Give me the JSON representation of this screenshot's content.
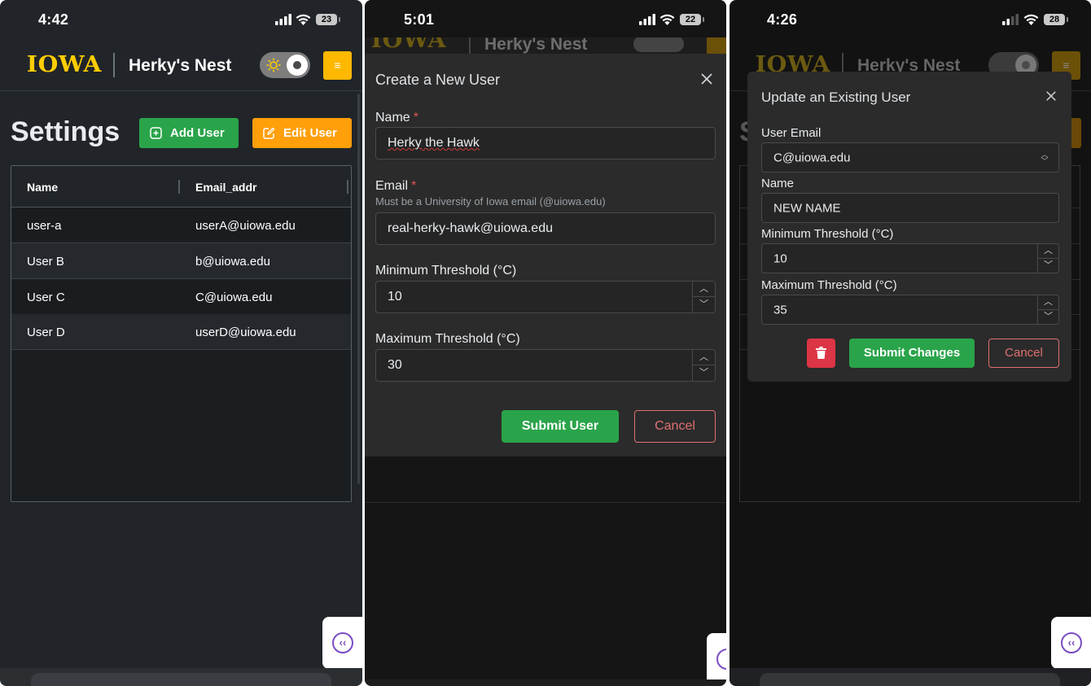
{
  "panel1": {
    "status": {
      "time": "4:42",
      "battery": "23"
    },
    "header": {
      "logo": "IOWA",
      "title": "Herky's Nest"
    },
    "page_title": "Settings",
    "add_user_label": "Add User",
    "edit_user_label": "Edit User",
    "table": {
      "columns": [
        "Name",
        "Email_addr"
      ],
      "rows": [
        {
          "name": "user-a",
          "email": "userA@uiowa.edu"
        },
        {
          "name": "User B",
          "email": "b@uiowa.edu"
        },
        {
          "name": "User C",
          "email": "C@uiowa.edu"
        },
        {
          "name": "User D",
          "email": "userD@uiowa.edu"
        }
      ]
    },
    "side_tab_icon": "‹‹"
  },
  "panel2": {
    "status": {
      "time": "5:01",
      "battery": "22"
    },
    "header": {
      "logo": "IOWA",
      "title": "Herky's Nest"
    },
    "modal": {
      "title": "Create a New User",
      "name_label": "Name",
      "name_value": "Herky the Hawk",
      "email_label": "Email",
      "email_hint": "Must be a University of Iowa email (@uiowa.edu)",
      "email_value": "real-herky-hawk@uiowa.edu",
      "min_label": "Minimum Threshold (°C)",
      "min_value": "10",
      "max_label": "Maximum Threshold (°C)",
      "max_value": "30",
      "submit_label": "Submit User",
      "cancel_label": "Cancel",
      "required_mark": "*"
    }
  },
  "panel3": {
    "status": {
      "time": "4:26",
      "battery": "28"
    },
    "header": {
      "logo": "IOWA",
      "title": "Herky's Nest"
    },
    "page_title_partial": "S",
    "modal": {
      "title": "Update an Existing User",
      "email_label": "User Email",
      "email_value": "C@uiowa.edu",
      "name_label": "Name",
      "name_value": "NEW NAME",
      "min_label": "Minimum Threshold (°C)",
      "min_value": "10",
      "max_label": "Maximum Threshold (°C)",
      "max_value": "35",
      "submit_label": "Submit Changes",
      "cancel_label": "Cancel"
    }
  },
  "colors": {
    "iowa_gold": "#ffcd00",
    "green": "#2aa44a",
    "orange": "#ff9f0a",
    "danger": "#dc3545",
    "cancel": "#e07070"
  }
}
